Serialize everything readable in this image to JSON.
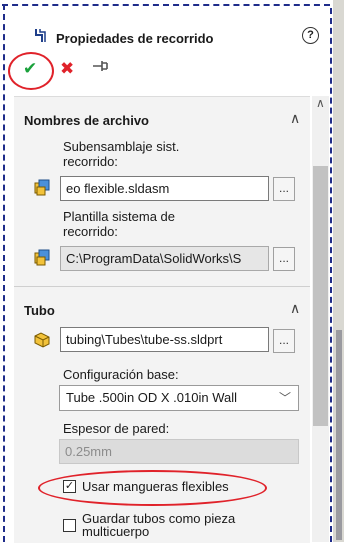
{
  "header": {
    "title": "Propiedades de recorrido",
    "help_icon": "?",
    "ok_glyph": "✔",
    "cancel_glyph": "✖",
    "pin_glyph": "⊣"
  },
  "sections": {
    "filenames": {
      "title": "Nombres de archivo",
      "subassembly_label": "Subensamblaje sist. recorrido:",
      "subassembly_value": "eo flexible.sldasm",
      "template_label": "Plantilla sistema de recorrido:",
      "template_value": "C:\\ProgramData\\SolidWorks\\S",
      "browse_label": "..."
    },
    "tube": {
      "title": "Tubo",
      "part_value": "tubing\\Tubes\\tube-ss.sldprt",
      "browse_label": "...",
      "config_label": "Configuración base:",
      "config_value": "Tube .500in OD X .010in Wall",
      "wall_label": "Espesor de pared:",
      "wall_value": "0.25mm",
      "flex_label": "Usar mangueras flexibles",
      "flex_checked": true,
      "multibody_label": "Guardar tubos como pieza multicuerpo",
      "multibody_checked": false
    }
  },
  "colors": {
    "accent_red": "#e0222a",
    "ok_green": "#1aa13b",
    "dash_blue": "#1f2c8a"
  }
}
